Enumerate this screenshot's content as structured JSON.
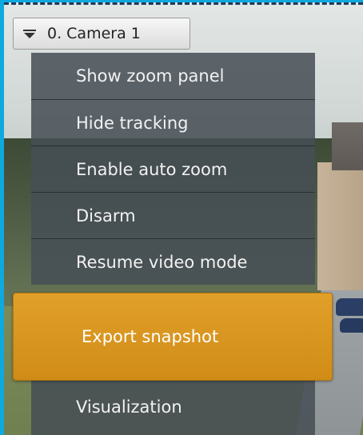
{
  "camera": {
    "title": "0. Camera 1",
    "icon": "dropdown-menu-icon"
  },
  "menu": {
    "items": [
      {
        "label": "Show zoom panel"
      },
      {
        "label": "Hide tracking"
      },
      {
        "label": "Enable auto zoom"
      },
      {
        "label": "Disarm"
      },
      {
        "label": "Resume video mode"
      },
      {
        "label": "Export snapshot",
        "highlighted": true
      },
      {
        "label": "Visualization"
      }
    ],
    "highlight_color": "#d8951f"
  },
  "frame_color": "#0ea9de"
}
